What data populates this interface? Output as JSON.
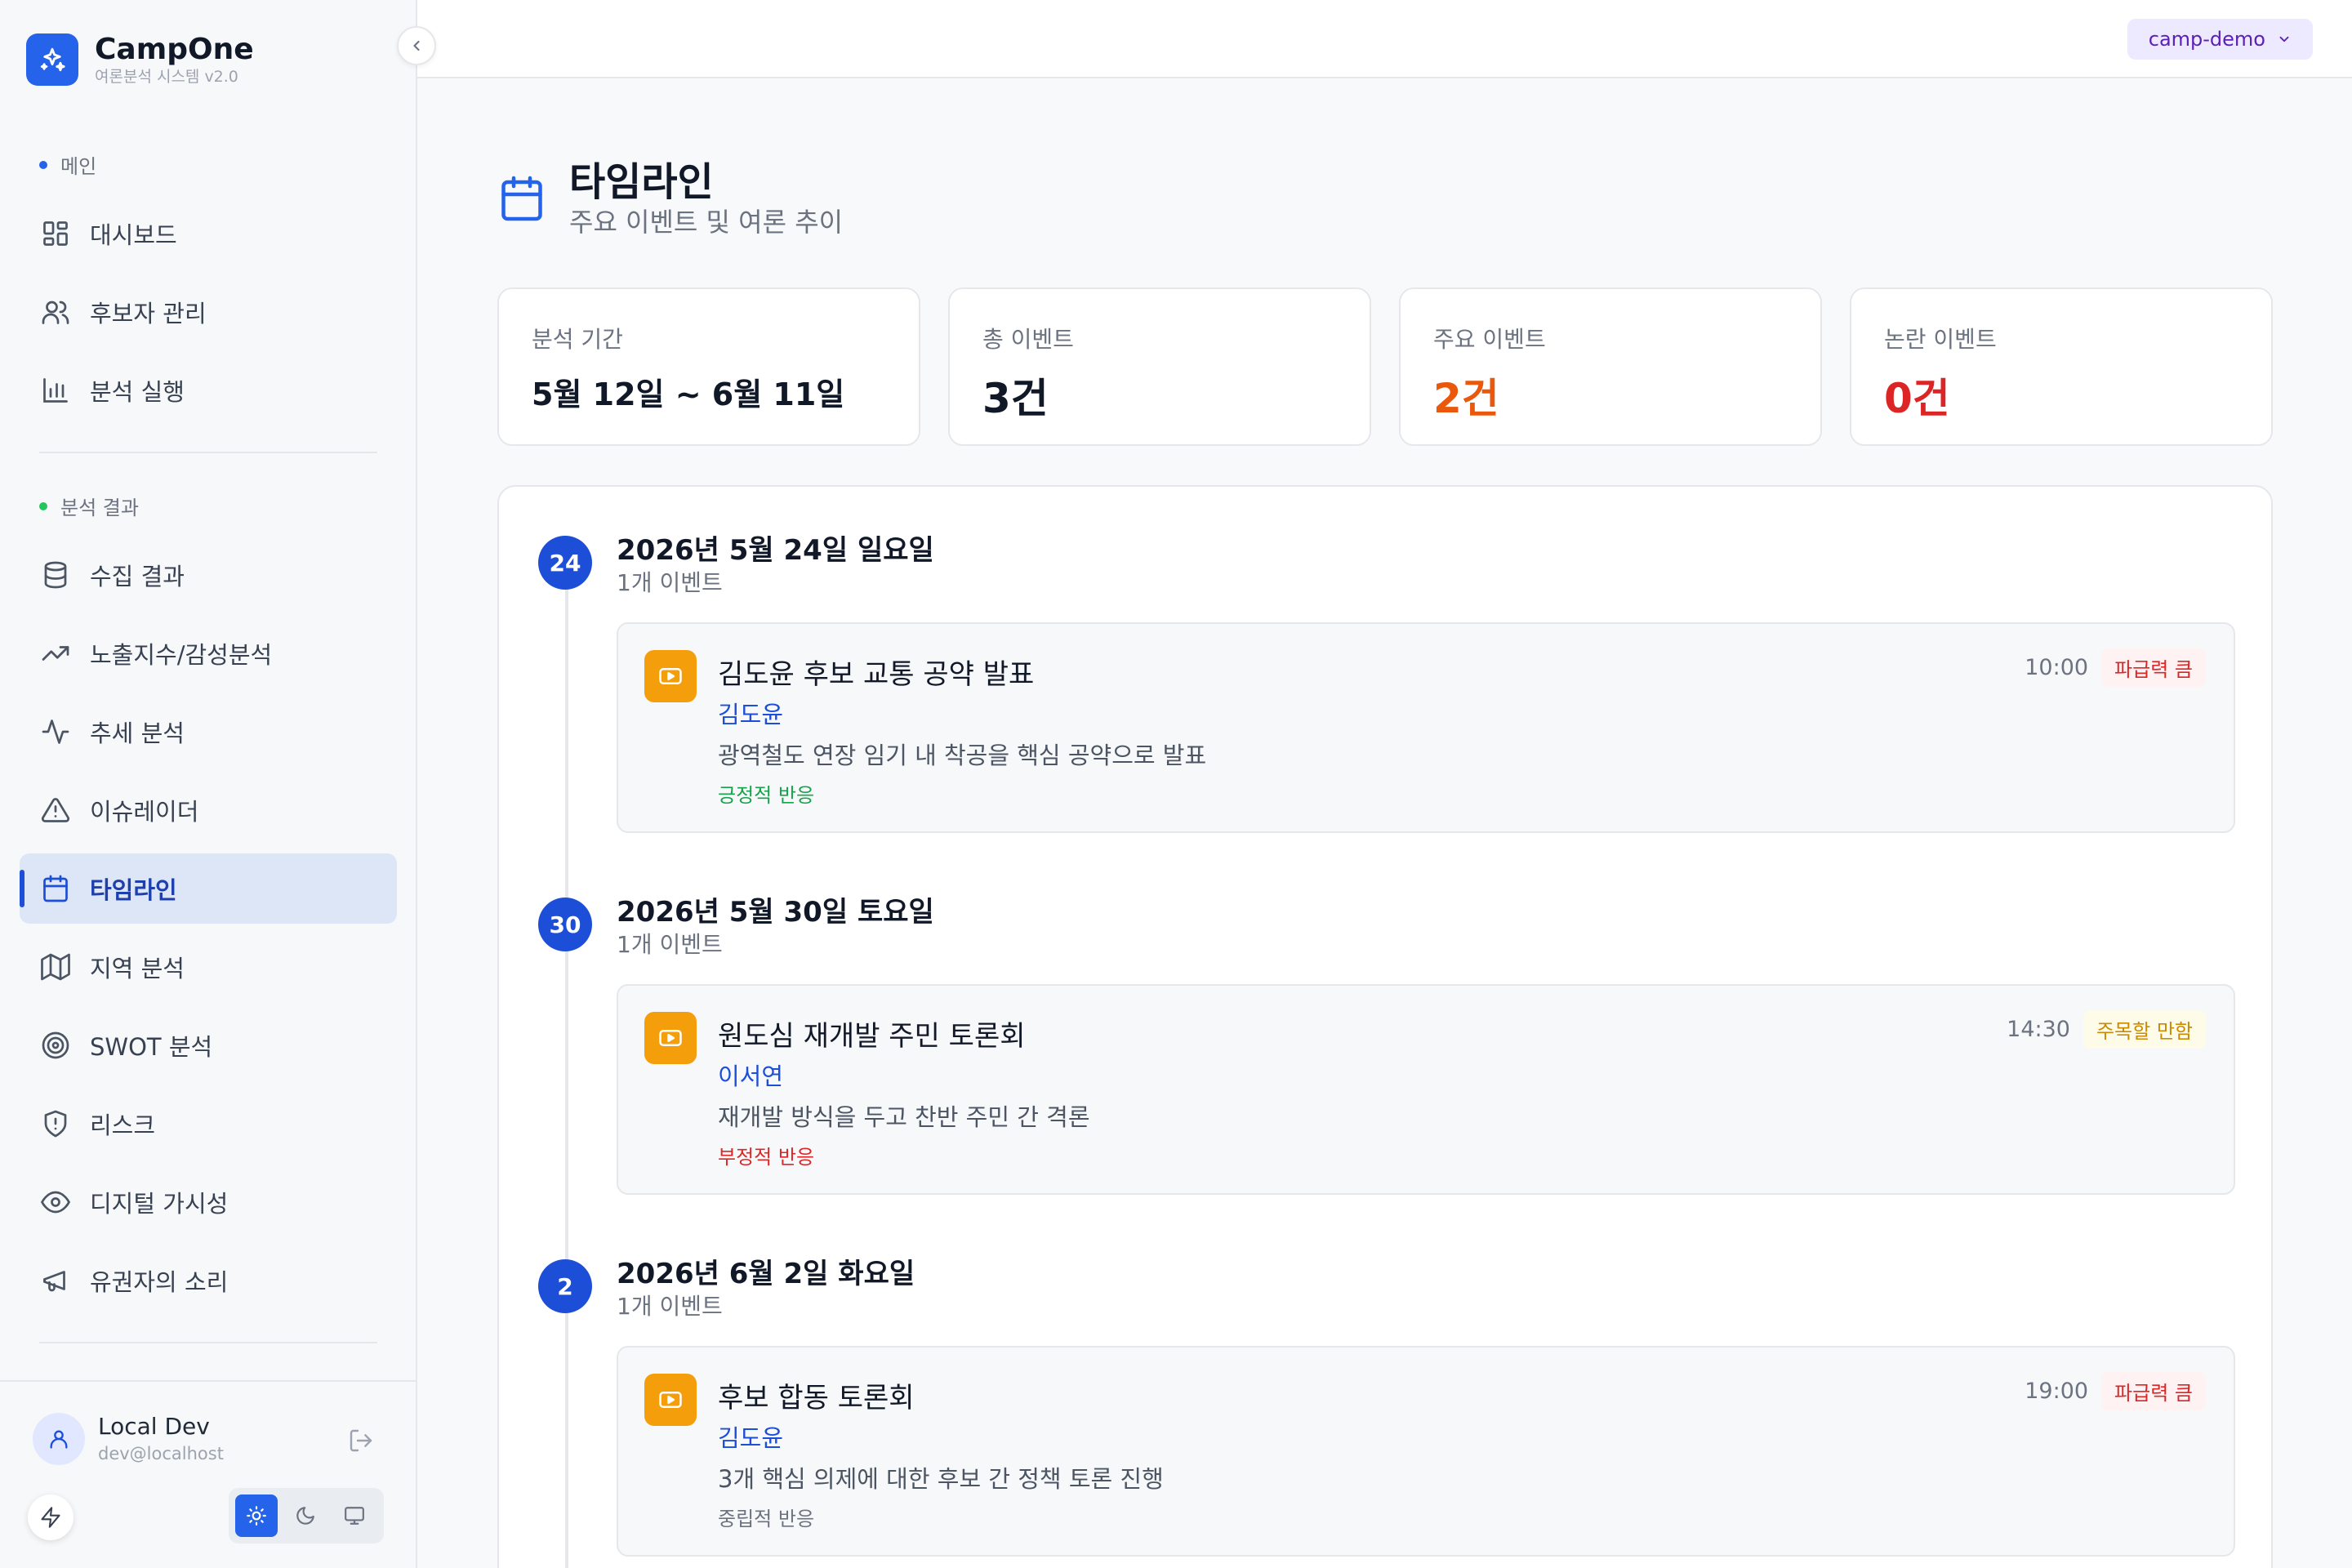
{
  "brand": {
    "name": "CampOne",
    "subtitle": "여론분석 시스템 v2.0"
  },
  "workspace": {
    "label": "camp-demo"
  },
  "sidebar": {
    "sections": [
      {
        "label": "메인",
        "dot_color": "#2563eb"
      },
      {
        "label": "분석 결과",
        "dot_color": "#22c55e"
      }
    ],
    "main_items": [
      {
        "label": "대시보드",
        "icon": "dashboard-icon"
      },
      {
        "label": "후보자 관리",
        "icon": "users-icon"
      },
      {
        "label": "분석 실행",
        "icon": "bar-chart-icon"
      }
    ],
    "result_items": [
      {
        "label": "수집 결과",
        "icon": "database-icon"
      },
      {
        "label": "노출지수/감성분석",
        "icon": "trending-up-icon"
      },
      {
        "label": "추세 분석",
        "icon": "activity-icon"
      },
      {
        "label": "이슈레이더",
        "icon": "alert-triangle-icon"
      },
      {
        "label": "타임라인",
        "icon": "calendar-icon",
        "active": true
      },
      {
        "label": "지역 분석",
        "icon": "map-icon"
      },
      {
        "label": "SWOT 분석",
        "icon": "target-icon"
      },
      {
        "label": "리스크",
        "icon": "shield-icon"
      },
      {
        "label": "디지털 가시성",
        "icon": "eye-icon"
      },
      {
        "label": "유권자의 소리",
        "icon": "megaphone-icon"
      }
    ]
  },
  "user": {
    "name": "Local Dev",
    "email": "dev@localhost"
  },
  "theme": {
    "selected": "light",
    "options": [
      "light",
      "dark",
      "system"
    ]
  },
  "page": {
    "title": "타임라인",
    "subtitle": "주요 이벤트 및 여론 추이"
  },
  "stats": [
    {
      "label": "분석 기간",
      "value": "5월 12일 ~ 6월 11일"
    },
    {
      "label": "총 이벤트",
      "value": "3건"
    },
    {
      "label": "주요 이벤트",
      "value": "2건",
      "color": "#ea580c"
    },
    {
      "label": "논란 이벤트",
      "value": "0건",
      "color": "#dc2626"
    }
  ],
  "timeline": [
    {
      "day": "24",
      "date": "2026년 5월 24일 일요일",
      "count": "1개 이벤트",
      "event": {
        "title": "김도윤 후보 교통 공약 발표",
        "person": "김도윤",
        "description": "광역철도 연장 임기 내 착공을 핵심 공약으로 발표",
        "reaction": "긍정적 반응",
        "reaction_type": "positive",
        "time": "10:00",
        "tag": "파급력 큼"
      }
    },
    {
      "day": "30",
      "date": "2026년 5월 30일 토요일",
      "count": "1개 이벤트",
      "event": {
        "title": "원도심 재개발 주민 토론회",
        "person": "이서연",
        "description": "재개발 방식을 두고 찬반 주민 간 격론",
        "reaction": "부정적 반응",
        "reaction_type": "negative",
        "time": "14:30",
        "tag": "주목할 만함"
      }
    },
    {
      "day": "2",
      "date": "2026년 6월 2일 화요일",
      "count": "1개 이벤트",
      "event": {
        "title": "후보 합동 토론회",
        "person": "김도윤",
        "description": "3개 핵심 의제에 대한 후보 간 정책 토론 진행",
        "reaction": "중립적 반응",
        "reaction_type": "neutral",
        "time": "19:00",
        "tag": "파급력 큼"
      }
    }
  ]
}
